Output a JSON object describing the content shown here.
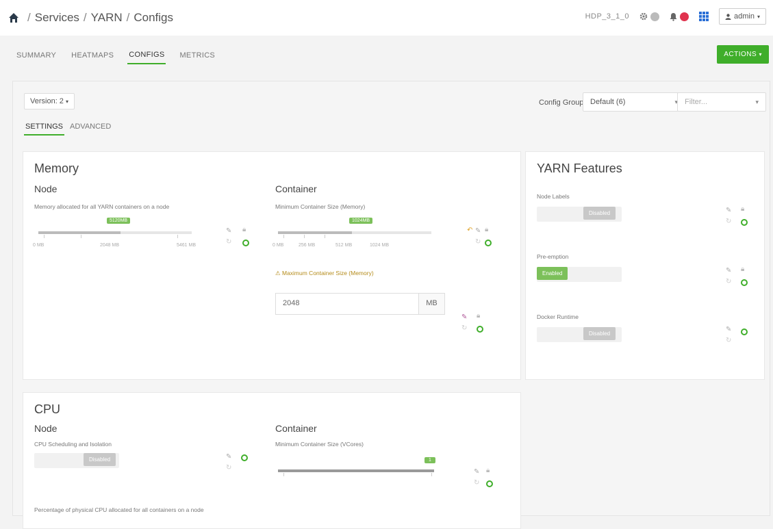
{
  "breadcrumb": {
    "items": [
      "Services",
      "YARN",
      "Configs"
    ]
  },
  "topbar": {
    "cluster_name": "HDP_3_1_0",
    "user_label": "admin"
  },
  "tabs": [
    {
      "label": "SUMMARY"
    },
    {
      "label": "HEATMAPS"
    },
    {
      "label": "CONFIGS",
      "active": true
    },
    {
      "label": "METRICS"
    }
  ],
  "actions_label": "ACTIONS",
  "version_label": "Version: 2",
  "config_group": {
    "label": "Config Group",
    "selected": "Default (6)",
    "filter_placeholder": "Filter..."
  },
  "subtabs": [
    {
      "label": "SETTINGS",
      "active": true
    },
    {
      "label": "ADVANCED"
    }
  ],
  "memory": {
    "title": "Memory",
    "node": {
      "title": "Node",
      "desc": "Memory allocated for all YARN containers on a node",
      "value_badge": "5120MB",
      "value_fraction": 0.45,
      "ticks": [
        "0 MB",
        "2048 MB",
        "5461 MB"
      ]
    },
    "container": {
      "title": "Container",
      "desc": "Minimum Container Size (Memory)",
      "value_badge": "1024MB",
      "value_fraction": 0.48,
      "ticks": [
        "0 MB",
        "256 MB",
        "512 MB",
        "1024 MB"
      ],
      "warning": "Maximum Container Size (Memory)",
      "max_value": "2048",
      "max_unit": "MB"
    }
  },
  "features": {
    "title": "YARN Features",
    "items": [
      {
        "label": "Node Labels",
        "state": "Disabled"
      },
      {
        "label": "Pre-emption",
        "state": "Enabled"
      },
      {
        "label": "Docker Runtime",
        "state": "Disabled"
      }
    ]
  },
  "cpu": {
    "title": "CPU",
    "node": {
      "title": "Node",
      "desc": "CPU Scheduling and Isolation",
      "state": "Disabled",
      "desc2": "Percentage of physical CPU allocated for all containers on a node"
    },
    "container": {
      "title": "Container",
      "desc": "Minimum Container Size (VCores)",
      "value_badge": "1",
      "value_fraction": 1.0
    }
  },
  "colors": {
    "accent": "#3fae2a",
    "alert": "#e0334e",
    "grid_icon": "#2a6fd6"
  }
}
